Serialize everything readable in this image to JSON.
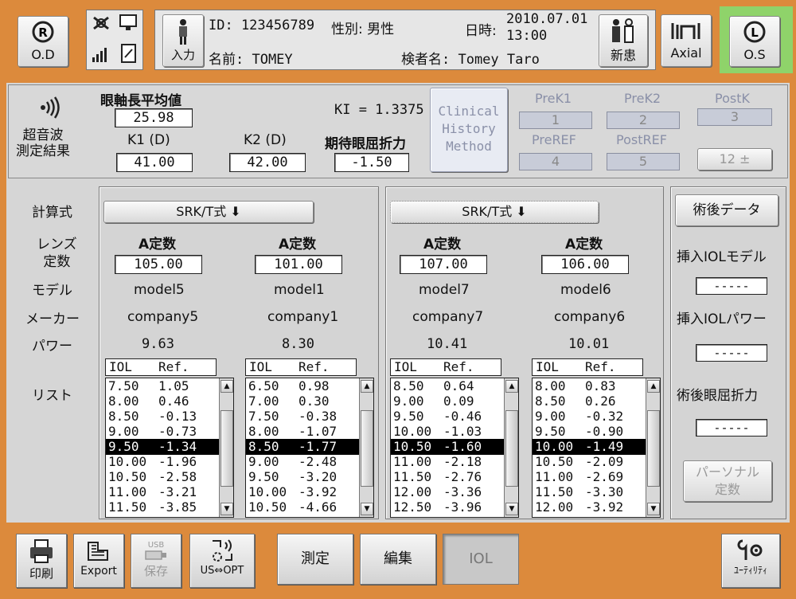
{
  "header": {
    "od_label": "O.D",
    "os_label": "O.S",
    "input_label": "入力",
    "patient_id": "ID: 123456789",
    "patient_name": "名前: TOMEY",
    "gender": "性別: 男性",
    "datetime_label": "日時:",
    "date": "2010.07.01",
    "time": "13:00",
    "examiner": "検者名: Tomey Taro",
    "new_patient_label": "新患",
    "axial_label": "Axial"
  },
  "ultrasound": {
    "section_label": "超音波\n測定結果",
    "axial_length_label": "眼軸長平均値",
    "axial_length_value": "25.98",
    "ki_label": "KI = 1.3375",
    "k1_label": "K1 (D)",
    "k1_value": "41.00",
    "k2_label": "K2 (D)",
    "k2_value": "42.00",
    "target_refraction_label": "期待眼屈折力",
    "target_refraction_value": "-1.50",
    "clinical_history_label": "Clinical\nHistory\nMethod",
    "prek1_label": "PreK1",
    "prek1_value": "1",
    "prek2_label": "PreK2",
    "prek2_value": "2",
    "postk_label": "PostK",
    "postk_value": "3",
    "preref_label": "PreREF",
    "preref_value": "4",
    "postref_label": "PostREF",
    "postref_value": "5",
    "dropdown_value": "12 ±"
  },
  "row_labels": {
    "formula": "計算式",
    "lens_constant": "レンズ\n定数",
    "model": "モデル",
    "maker": "メーカー",
    "power": "パワー",
    "list": "リスト"
  },
  "groups": [
    {
      "formula": "SRK/T式 ⬇"
    },
    {
      "formula": "SRK/T式 ⬇"
    }
  ],
  "lenses": [
    {
      "constant_label": "A定数",
      "constant": "105.00",
      "model": "model5",
      "maker": "company5",
      "power": "9.63",
      "list_header_iol": "IOL",
      "list_header_ref": "Ref.",
      "rows": [
        [
          "7.50",
          "1.05"
        ],
        [
          "8.00",
          "0.46"
        ],
        [
          "8.50",
          "-0.13"
        ],
        [
          "9.00",
          "-0.73"
        ],
        [
          "9.50",
          "-1.34"
        ],
        [
          "10.00",
          "-1.96"
        ],
        [
          "10.50",
          "-2.58"
        ],
        [
          "11.00",
          "-3.21"
        ],
        [
          "11.50",
          "-3.85"
        ]
      ],
      "selected": 4
    },
    {
      "constant_label": "A定数",
      "constant": "101.00",
      "model": "model1",
      "maker": "company1",
      "power": "8.30",
      "list_header_iol": "IOL",
      "list_header_ref": "Ref.",
      "rows": [
        [
          "6.50",
          "0.98"
        ],
        [
          "7.00",
          "0.30"
        ],
        [
          "7.50",
          "-0.38"
        ],
        [
          "8.00",
          "-1.07"
        ],
        [
          "8.50",
          "-1.77"
        ],
        [
          "9.00",
          "-2.48"
        ],
        [
          "9.50",
          "-3.20"
        ],
        [
          "10.00",
          "-3.92"
        ],
        [
          "10.50",
          "-4.66"
        ]
      ],
      "selected": 4
    },
    {
      "constant_label": "A定数",
      "constant": "107.00",
      "model": "model7",
      "maker": "company7",
      "power": "10.41",
      "list_header_iol": "IOL",
      "list_header_ref": "Ref.",
      "rows": [
        [
          "8.50",
          "0.64"
        ],
        [
          "9.00",
          "0.09"
        ],
        [
          "9.50",
          "-0.46"
        ],
        [
          "10.00",
          "-1.03"
        ],
        [
          "10.50",
          "-1.60"
        ],
        [
          "11.00",
          "-2.18"
        ],
        [
          "11.50",
          "-2.76"
        ],
        [
          "12.00",
          "-3.36"
        ],
        [
          "12.50",
          "-3.96"
        ]
      ],
      "selected": 4
    },
    {
      "constant_label": "A定数",
      "constant": "106.00",
      "model": "model6",
      "maker": "company6",
      "power": "10.01",
      "list_header_iol": "IOL",
      "list_header_ref": "Ref.",
      "rows": [
        [
          "8.00",
          "0.83"
        ],
        [
          "8.50",
          "0.26"
        ],
        [
          "9.00",
          "-0.32"
        ],
        [
          "9.50",
          "-0.90"
        ],
        [
          "10.00",
          "-1.49"
        ],
        [
          "10.50",
          "-2.09"
        ],
        [
          "11.00",
          "-2.69"
        ],
        [
          "11.50",
          "-3.30"
        ],
        [
          "12.00",
          "-3.92"
        ]
      ],
      "selected": 4
    }
  ],
  "postop": {
    "title": "術後データ",
    "iol_model_label": "挿入IOLモデル",
    "iol_model_value": "-----",
    "iol_power_label": "挿入IOLパワー",
    "iol_power_value": "-----",
    "refraction_label": "術後眼屈折力",
    "refraction_value": "-----",
    "personal_constant_label": "パーソナル\n定数"
  },
  "toolbar": {
    "print_label": "印刷",
    "export_label": "Export",
    "save_label": "保存",
    "usb_label": "USB",
    "us_opt_label": "US⇔OPT",
    "measure_label": "測定",
    "edit_label": "編集",
    "iol_label": "IOL",
    "utility_label": "ﾕｰﾃｨﾘﾃｨ"
  },
  "colors": {
    "orange_frame": "#dc8a3c",
    "green_os": "#8fd36a",
    "panel_gray": "#d4d4d4",
    "disabled_blue": "#8a90a8"
  }
}
